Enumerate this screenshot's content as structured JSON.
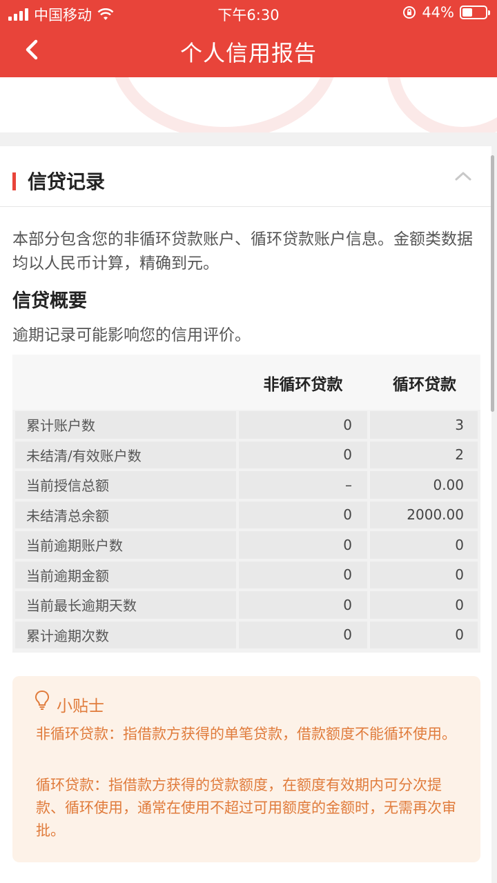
{
  "status_bar": {
    "carrier": "中国移动",
    "time": "下午6:30",
    "battery": "44%",
    "battery_level": 0.44
  },
  "nav": {
    "title": "个人信用报告",
    "back_icon": "chevron-left-icon"
  },
  "section": {
    "title": "信贷记录",
    "collapse_icon": "chevron-up-icon",
    "intro": "本部分包含您的非循环贷款账户、循环贷款账户信息。金额类数据均以人民币计算，精确到元。",
    "summary_title": "信贷概要",
    "summary_note": "逾期记录可能影响您的信用评价。"
  },
  "table": {
    "col1": "非循环贷款",
    "col2": "循环贷款",
    "rows": [
      {
        "name": "累计账户数",
        "v1": "0",
        "v2": "3"
      },
      {
        "name": "未结清/有效账户数",
        "v1": "0",
        "v2": "2"
      },
      {
        "name": "当前授信总额",
        "v1": "–",
        "v2": "0.00"
      },
      {
        "name": "未结清总余额",
        "v1": "0",
        "v2": "2000.00"
      },
      {
        "name": "当前逾期账户数",
        "v1": "0",
        "v2": "0"
      },
      {
        "name": "当前逾期金额",
        "v1": "0",
        "v2": "0"
      },
      {
        "name": "当前最长逾期天数",
        "v1": "0",
        "v2": "0"
      },
      {
        "name": "累计逾期次数",
        "v1": "0",
        "v2": "0"
      }
    ]
  },
  "tips": {
    "title": "小贴士",
    "icon": "lightbulb-icon",
    "p1": "非循环贷款：指借款方获得的单笔贷款，借款额度不能循环使用。",
    "p2": "循环贷款：指借款方获得的贷款额度，在额度有效期内可分次提款、循环使用，通常在使用不超过可用额度的金额时，无需再次审批。"
  },
  "colors": {
    "brand": "#e8443a",
    "tips_bg": "#fdf2e8",
    "tips_text": "#e07b3b"
  }
}
